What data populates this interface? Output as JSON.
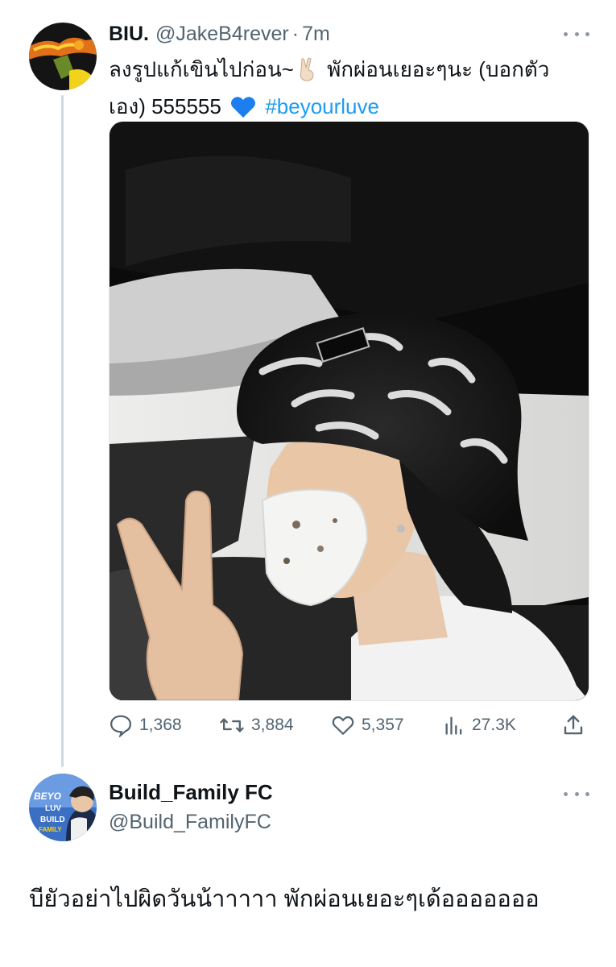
{
  "tweet1": {
    "author_name": "BIU.",
    "author_handle": "@JakeB4rever",
    "separator": "·",
    "time": "7m",
    "text_part1": "ลงรูปแก้เขินไปก่อน~",
    "text_part2": "พักผ่อนเยอะๆนะ (บอกตัว",
    "text_part3": "เอง) 555555",
    "hashtag": "#beyourluve",
    "emoji_1": "victory-hand",
    "emoji_2": "blue-heart",
    "stats": {
      "replies": "1,368",
      "retweets": "3,884",
      "likes": "5,357",
      "views": "27.3K"
    }
  },
  "tweet2": {
    "author_name": "Build_Family FC",
    "author_handle": "@Build_FamilyFC",
    "text": "บียัวอย่าไปผิดวันน้าาาาา พักผ่อนเยอะๆเด้อออออออ",
    "avatar_text": "BUILD"
  },
  "colors": {
    "accent": "#1d9bf0",
    "secondary_text": "#536471",
    "thread_line": "#cfd9de"
  },
  "icons": {
    "reply": "reply-icon",
    "retweet": "retweet-icon",
    "like": "heart-icon",
    "views": "views-icon",
    "share": "share-icon",
    "more": "more-icon"
  }
}
